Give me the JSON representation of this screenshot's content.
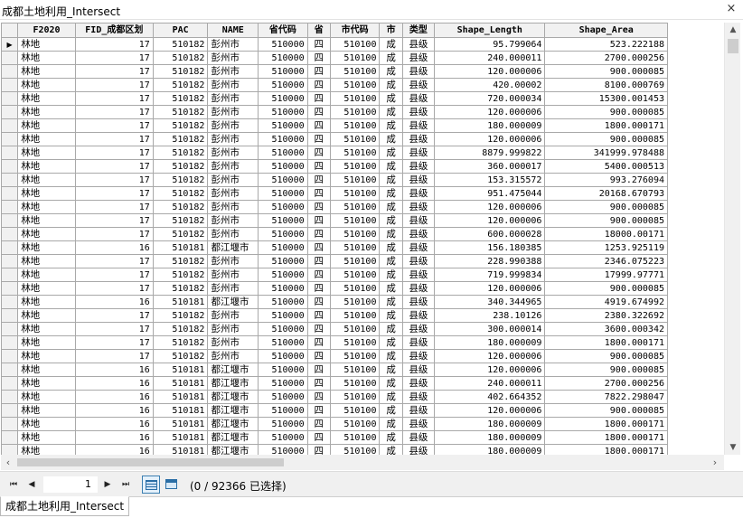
{
  "window": {
    "title": "成都土地利用_Intersect",
    "close_glyph": "×"
  },
  "table": {
    "columns": [
      "F2020",
      "FID_成都区划",
      "PAC",
      "NAME",
      "省代码",
      "省",
      "市代码",
      "市",
      "类型",
      "Shape_Length",
      "Shape_Area"
    ],
    "rows": [
      [
        "林地",
        "17",
        "510182",
        "彭州市",
        "510000",
        "四",
        "510100",
        "成",
        "县级",
        "95.799064",
        "523.222188"
      ],
      [
        "林地",
        "17",
        "510182",
        "彭州市",
        "510000",
        "四",
        "510100",
        "成",
        "县级",
        "240.000011",
        "2700.000256"
      ],
      [
        "林地",
        "17",
        "510182",
        "彭州市",
        "510000",
        "四",
        "510100",
        "成",
        "县级",
        "120.000006",
        "900.000085"
      ],
      [
        "林地",
        "17",
        "510182",
        "彭州市",
        "510000",
        "四",
        "510100",
        "成",
        "县级",
        "420.00002",
        "8100.000769"
      ],
      [
        "林地",
        "17",
        "510182",
        "彭州市",
        "510000",
        "四",
        "510100",
        "成",
        "县级",
        "720.000034",
        "15300.001453"
      ],
      [
        "林地",
        "17",
        "510182",
        "彭州市",
        "510000",
        "四",
        "510100",
        "成",
        "县级",
        "120.000006",
        "900.000085"
      ],
      [
        "林地",
        "17",
        "510182",
        "彭州市",
        "510000",
        "四",
        "510100",
        "成",
        "县级",
        "180.000009",
        "1800.000171"
      ],
      [
        "林地",
        "17",
        "510182",
        "彭州市",
        "510000",
        "四",
        "510100",
        "成",
        "县级",
        "120.000006",
        "900.000085"
      ],
      [
        "林地",
        "17",
        "510182",
        "彭州市",
        "510000",
        "四",
        "510100",
        "成",
        "县级",
        "8879.999822",
        "341999.978488"
      ],
      [
        "林地",
        "17",
        "510182",
        "彭州市",
        "510000",
        "四",
        "510100",
        "成",
        "县级",
        "360.000017",
        "5400.000513"
      ],
      [
        "林地",
        "17",
        "510182",
        "彭州市",
        "510000",
        "四",
        "510100",
        "成",
        "县级",
        "153.315572",
        "993.276094"
      ],
      [
        "林地",
        "17",
        "510182",
        "彭州市",
        "510000",
        "四",
        "510100",
        "成",
        "县级",
        "951.475044",
        "20168.670793"
      ],
      [
        "林地",
        "17",
        "510182",
        "彭州市",
        "510000",
        "四",
        "510100",
        "成",
        "县级",
        "120.000006",
        "900.000085"
      ],
      [
        "林地",
        "17",
        "510182",
        "彭州市",
        "510000",
        "四",
        "510100",
        "成",
        "县级",
        "120.000006",
        "900.000085"
      ],
      [
        "林地",
        "17",
        "510182",
        "彭州市",
        "510000",
        "四",
        "510100",
        "成",
        "县级",
        "600.000028",
        "18000.00171"
      ],
      [
        "林地",
        "16",
        "510181",
        "都江堰市",
        "510000",
        "四",
        "510100",
        "成",
        "县级",
        "156.180385",
        "1253.925119"
      ],
      [
        "林地",
        "17",
        "510182",
        "彭州市",
        "510000",
        "四",
        "510100",
        "成",
        "县级",
        "228.990388",
        "2346.075223"
      ],
      [
        "林地",
        "17",
        "510182",
        "彭州市",
        "510000",
        "四",
        "510100",
        "成",
        "县级",
        "719.999834",
        "17999.97771"
      ],
      [
        "林地",
        "17",
        "510182",
        "彭州市",
        "510000",
        "四",
        "510100",
        "成",
        "县级",
        "120.000006",
        "900.000085"
      ],
      [
        "林地",
        "16",
        "510181",
        "都江堰市",
        "510000",
        "四",
        "510100",
        "成",
        "县级",
        "340.344965",
        "4919.674992"
      ],
      [
        "林地",
        "17",
        "510182",
        "彭州市",
        "510000",
        "四",
        "510100",
        "成",
        "县级",
        "238.10126",
        "2380.322692"
      ],
      [
        "林地",
        "17",
        "510182",
        "彭州市",
        "510000",
        "四",
        "510100",
        "成",
        "县级",
        "300.000014",
        "3600.000342"
      ],
      [
        "林地",
        "17",
        "510182",
        "彭州市",
        "510000",
        "四",
        "510100",
        "成",
        "县级",
        "180.000009",
        "1800.000171"
      ],
      [
        "林地",
        "17",
        "510182",
        "彭州市",
        "510000",
        "四",
        "510100",
        "成",
        "县级",
        "120.000006",
        "900.000085"
      ],
      [
        "林地",
        "16",
        "510181",
        "都江堰市",
        "510000",
        "四",
        "510100",
        "成",
        "县级",
        "120.000006",
        "900.000085"
      ],
      [
        "林地",
        "16",
        "510181",
        "都江堰市",
        "510000",
        "四",
        "510100",
        "成",
        "县级",
        "240.000011",
        "2700.000256"
      ],
      [
        "林地",
        "16",
        "510181",
        "都江堰市",
        "510000",
        "四",
        "510100",
        "成",
        "县级",
        "402.664352",
        "7822.298047"
      ],
      [
        "林地",
        "16",
        "510181",
        "都江堰市",
        "510000",
        "四",
        "510100",
        "成",
        "县级",
        "120.000006",
        "900.000085"
      ],
      [
        "林地",
        "16",
        "510181",
        "都江堰市",
        "510000",
        "四",
        "510100",
        "成",
        "县级",
        "180.000009",
        "1800.000171"
      ],
      [
        "林地",
        "16",
        "510181",
        "都江堰市",
        "510000",
        "四",
        "510100",
        "成",
        "县级",
        "180.000009",
        "1800.000171"
      ],
      [
        "林地",
        "16",
        "510181",
        "都江堰市",
        "510000",
        "四",
        "510100",
        "成",
        "县级",
        "180.000009",
        "1800.000171"
      ]
    ],
    "current_row_marker": "▶"
  },
  "scrollbars": {
    "up": "▲",
    "down": "▼",
    "left": "‹",
    "right": "›"
  },
  "navigator": {
    "first": "⏮",
    "prev": "◀",
    "next": "▶",
    "last": "⏭",
    "page": "1",
    "status": "(0 / 92366 已选择)"
  },
  "tabs": [
    {
      "label": "成都土地利用_Intersect"
    }
  ],
  "colors": {
    "header_bg": "#f1f1f1",
    "grid_line": "#a9a9a9",
    "toggle_accent": "#3c7fb1"
  }
}
